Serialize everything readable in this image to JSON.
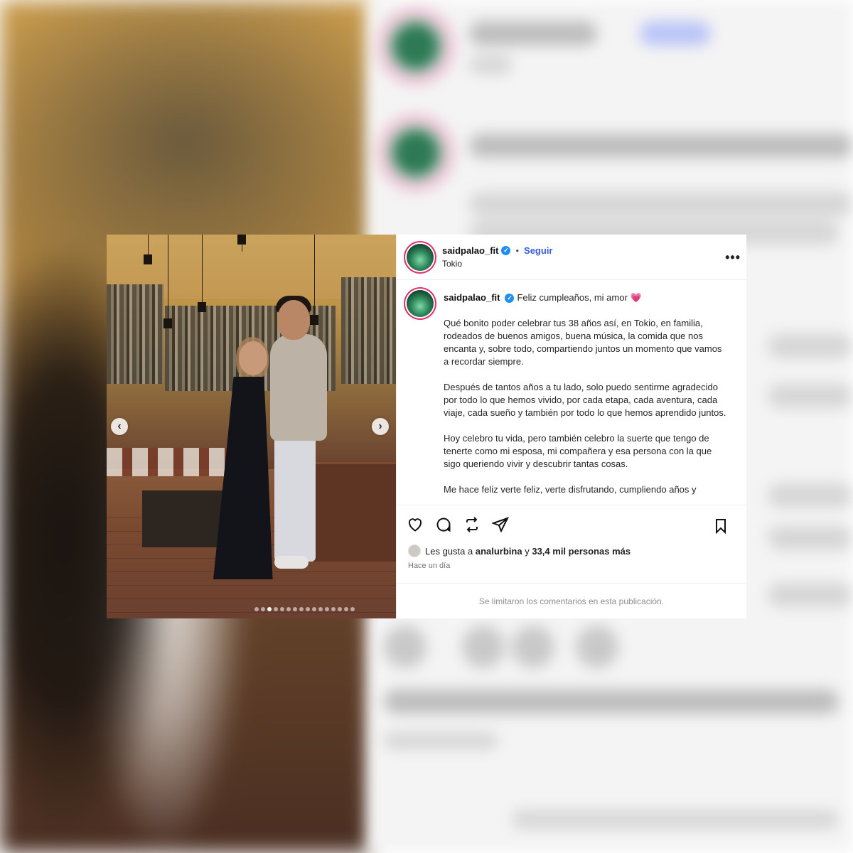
{
  "post": {
    "username": "saidpalao_fit",
    "verified_badge": "✓",
    "separator": "•",
    "follow_label": "Seguir",
    "location": "Tokio",
    "more_icon": "•••",
    "caption": {
      "first_line": "Feliz cumpleaños, mi amor",
      "heart": "💗",
      "paragraphs": [
        "Qué bonito poder celebrar tus 38 años así, en Tokio, en familia, rodeados de buenos amigos, buena música, la comida que nos encanta y, sobre todo, compartiendo juntos un momento que vamos a recordar siempre.",
        "Después de tantos años a tu lado, solo puedo sentirme agradecido por todo lo que hemos vivido, por cada etapa, cada aventura, cada viaje, cada sueño y también por todo lo que hemos aprendido juntos.",
        "Hoy celebro tu vida, pero también celebro la suerte que tengo de tenerte como mi esposa, mi compañera y esa persona con la que sigo queriendo vivir y descubrir tantas cosas.",
        "Me hace feliz verte feliz, verte disfrutando, cumpliendo años y"
      ]
    },
    "likes": {
      "prefix": "Les gusta a",
      "user": "analurbina",
      "connector": "y",
      "count": "33,4 mil personas más"
    },
    "time": "Hace un día",
    "comments_notice": "Se limitaron los comentarios en esta publicación.",
    "carousel": {
      "total": 16,
      "active_index": 2,
      "prev": "‹",
      "next": "›"
    }
  }
}
